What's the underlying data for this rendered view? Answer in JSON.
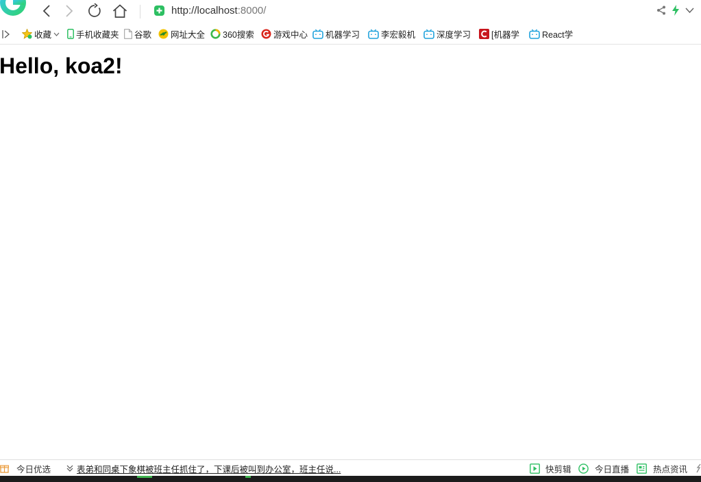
{
  "toolbar": {
    "url_host": "http://localhost",
    "url_port": ":8000/"
  },
  "bookmarks": [
    {
      "label": "收藏",
      "icon": "star-icon"
    },
    {
      "label": "手机收藏夹",
      "icon": "phone-icon"
    },
    {
      "label": "谷歌",
      "icon": "page-icon"
    },
    {
      "label": "网址大全",
      "icon": "globe-icon"
    },
    {
      "label": "360搜索",
      "icon": "ring-icon"
    },
    {
      "label": "游戏中心",
      "icon": "game-icon"
    },
    {
      "label": "机器学习",
      "icon": "bilibili-icon"
    },
    {
      "label": "李宏毅机",
      "icon": "bilibili-icon"
    },
    {
      "label": "深度学习",
      "icon": "bilibili-icon"
    },
    {
      "label": "[机器学",
      "icon": "csdn-icon"
    },
    {
      "label": "React学",
      "icon": "bilibili-icon"
    }
  ],
  "page": {
    "heading": "Hello, koa2!"
  },
  "statusbar": {
    "today_label": "今日优选",
    "news_text": "表弟和同桌下象棋被班主任抓住了，下课后被叫到办公室，班主任说...",
    "clip_label": "快剪辑",
    "live_label": "今日直播",
    "hot_label": "热点资讯"
  },
  "colors": {
    "brand_green": "#2dbf62",
    "bilibili_blue": "#1fa2dc",
    "csdn_red": "#c8161d",
    "game_red": "#d9261c"
  }
}
